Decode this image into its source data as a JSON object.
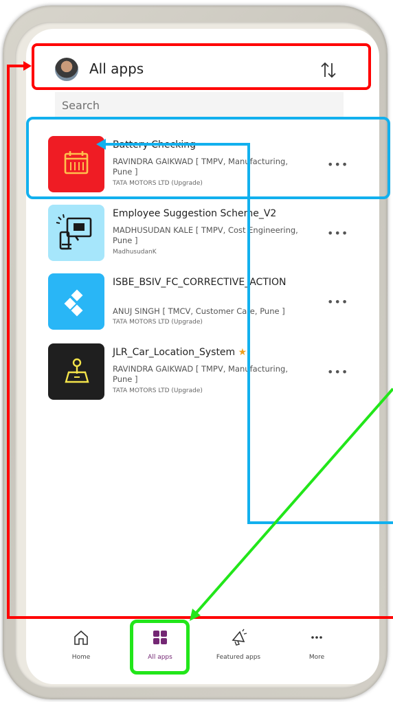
{
  "header": {
    "title": "All apps"
  },
  "search": {
    "placeholder": "Search"
  },
  "apps": [
    {
      "title": "Battery Checking",
      "owner": "RAVINDRA GAIKWAD [ TMPV, Manufacturing, Pune ]",
      "org": "TATA MOTORS LTD (Upgrade)",
      "color": "#ef1c24",
      "icon": "calendar-icon"
    },
    {
      "title": "Employee Suggestion Scheme_V2",
      "owner": "MADHUSUDAN KALE [ TMPV, Cost Engineering, Pune ]",
      "org": "MadhusudanK",
      "color": "#a6e6fb",
      "icon": "suggestion-icon"
    },
    {
      "title": "ISBE_BSIV_FC_CORRECTIVE_ACTION",
      "owner": "ANUJ SINGH [ TMCV, Customer Care, Pune ]",
      "org": "TATA MOTORS LTD (Upgrade)",
      "color": "#29b6f6",
      "icon": "diamond-icon"
    },
    {
      "title": "JLR_Car_Location_System",
      "owner": "RAVINDRA GAIKWAD [ TMPV, Manufacturing, Pune ]",
      "org": "TATA MOTORS LTD (Upgrade)",
      "color": "#1f1f1f",
      "icon": "map-pin-icon"
    }
  ],
  "more_label": "•••",
  "nav": [
    {
      "label": "Home",
      "icon": "home-icon"
    },
    {
      "label": "All apps",
      "icon": "apps-grid-icon",
      "active": true
    },
    {
      "label": "Featured apps",
      "icon": "megaphone-icon"
    },
    {
      "label": "More",
      "icon": "more-icon"
    }
  ],
  "colors": {
    "accent": "#742774",
    "annot_red": "#ff0000",
    "annot_blue": "#12b0ee",
    "annot_green": "#22e61a"
  }
}
